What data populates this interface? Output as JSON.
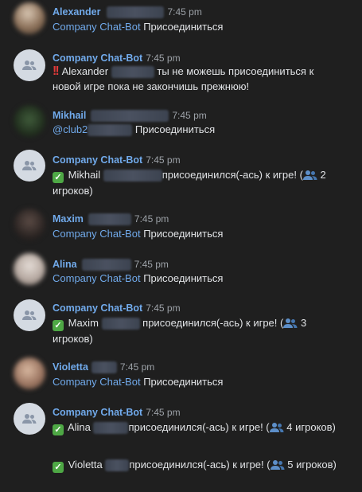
{
  "messages": [
    {
      "author": "Alexander",
      "time": "7:45 pm",
      "lines": [
        {
          "link": "Company Chat-Bot",
          "text": "Присоединиться"
        }
      ]
    },
    {
      "author": "Company Chat-Bot",
      "time": "7:45 pm",
      "emoji": "double-exclamation-icon",
      "pre": "Alexander",
      "post": "ты не можешь присоединиться к новой игре пока не закончишь прежнюю!"
    },
    {
      "author": "Mikhail",
      "time": "7:45 pm",
      "lines": [
        {
          "link": "@club2",
          "text": "Присоединиться"
        }
      ]
    },
    {
      "author": "Company Chat-Bot",
      "time": "7:45 pm",
      "emoji": "check-mark-icon",
      "pre": "Mikhail",
      "post": "присоединился(-ась) к игре! (",
      "count": "2",
      "tail": "игроков)"
    },
    {
      "author": "Maxim",
      "time": "7:45 pm",
      "lines": [
        {
          "link": "Company Chat-Bot",
          "text": "Присоединиться"
        }
      ]
    },
    {
      "author": "Alina",
      "time": "7:45 pm",
      "lines": [
        {
          "link": "Company Chat-Bot",
          "text": "Присоединиться"
        }
      ]
    },
    {
      "author": "Company Chat-Bot",
      "time": "7:45 pm",
      "emoji": "check-mark-icon",
      "pre": "Maxim",
      "post": "присоединился(-ась) к игре! (",
      "count": "3",
      "tail": "игроков)"
    },
    {
      "author": "Violetta",
      "time": "7:45 pm",
      "lines": [
        {
          "link": "Company Chat-Bot",
          "text": "Присоединиться"
        }
      ]
    },
    {
      "author": "Company Chat-Bot",
      "time": "7:45 pm",
      "emoji": "check-mark-icon",
      "pre": "Alina",
      "post": "присоединился(-ась) к игре! (",
      "count": "4",
      "tail": "игроков)",
      "second": {
        "pre": "Violetta",
        "post": "присоединился(-ась) к игре! (",
        "count": "5",
        "tail": "игроков)"
      }
    }
  ],
  "colors": {
    "background": "#1f1f1f",
    "link": "#71aaeb",
    "text": "#e1e3e6",
    "time": "#9da2a8"
  }
}
